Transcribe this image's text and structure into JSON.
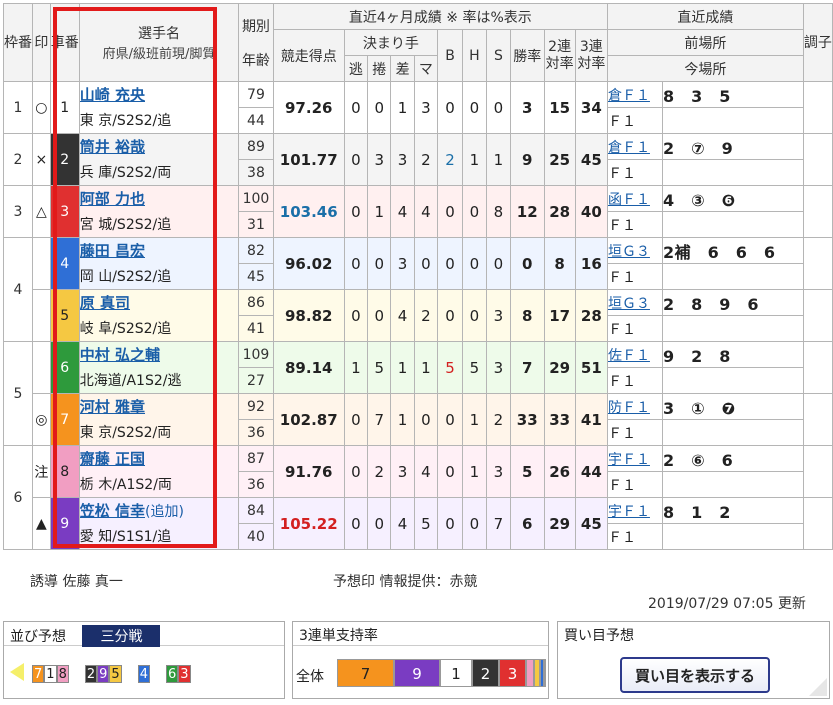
{
  "header": {
    "waku": "枠番",
    "shirushi": "印",
    "sha": "車番",
    "player_line1": "選手名",
    "player_line2": "府県/級班前現/脚質",
    "age_top": "期別",
    "age_bottom": "年齢",
    "recent4": "直近4ヶ月成績 ※ 率は%表示",
    "score": "競走得点",
    "kimarite": "決まり手",
    "k_nige": "逃",
    "k_makuri": "捲",
    "k_sashi": "差",
    "k_mark": "マ",
    "b": "B",
    "h": "H",
    "s": "S",
    "shoritsu": "勝率",
    "nirentai": "2連対率",
    "sanrentai": "3連対率",
    "recent": "直近成績",
    "zenba": "前場所",
    "konba": "今場所",
    "chosi": "調子"
  },
  "rows": [
    {
      "waku": "1",
      "mark": "○",
      "car": "1",
      "car_color": "#ffffff",
      "car_text": "#222222",
      "bg": "#ffffff",
      "name": "山崎 充央",
      "suffix": "",
      "pref": "東 京/S2S2/追",
      "ki": "79",
      "age": "44",
      "score": "97.26",
      "score_color": "",
      "nige": "0",
      "makuri": "0",
      "sashi": "1",
      "mark_k": "3",
      "b": "0",
      "b_color": "",
      "h": "0",
      "s": "0",
      "win": "3",
      "r2": "15",
      "r3": "34",
      "prev": "倉Ｆ１",
      "prev_res": "8　3　5",
      "cur": "Ｆ１",
      "cur_res": ""
    },
    {
      "waku": "2",
      "mark": "×",
      "car": "2",
      "car_color": "#333333",
      "car_text": "#ffffff",
      "bg": "#f4f4f4",
      "name": "筒井 裕哉",
      "suffix": "",
      "pref": "兵 庫/S2S2/両",
      "ki": "89",
      "age": "38",
      "score": "101.77",
      "score_color": "",
      "nige": "0",
      "makuri": "3",
      "sashi": "3",
      "mark_k": "2",
      "b": "2",
      "b_color": "blue",
      "h": "1",
      "s": "1",
      "win": "9",
      "r2": "25",
      "r3": "45",
      "prev": "倉Ｆ１",
      "prev_res": "2　⑦　9",
      "cur": "Ｆ１",
      "cur_res": ""
    },
    {
      "waku": "3",
      "mark": "△",
      "car": "3",
      "car_color": "#e03030",
      "car_text": "#ffffff",
      "bg": "#fff0f0",
      "name": "阿部 力也",
      "suffix": "",
      "pref": "宮 城/S2S2/追",
      "ki": "100",
      "age": "31",
      "score": "103.46",
      "score_color": "blue",
      "nige": "0",
      "makuri": "1",
      "sashi": "4",
      "mark_k": "4",
      "b": "0",
      "b_color": "",
      "h": "0",
      "s": "8",
      "win": "12",
      "r2": "28",
      "r3": "40",
      "prev": "函Ｆ１",
      "prev_res": "4　③　❻",
      "cur": "Ｆ１",
      "cur_res": ""
    },
    {
      "waku": "4",
      "mark": "",
      "car": "4",
      "car_color": "#2f6fd6",
      "car_text": "#ffffff",
      "bg": "#eef4ff",
      "name": "藤田 昌宏",
      "suffix": "",
      "pref": "岡 山/S2S2/追",
      "ki": "82",
      "age": "45",
      "score": "96.02",
      "score_color": "",
      "nige": "0",
      "makuri": "0",
      "sashi": "3",
      "mark_k": "0",
      "b": "0",
      "b_color": "",
      "h": "0",
      "s": "0",
      "win": "0",
      "r2": "8",
      "r3": "16",
      "prev": "垣Ｇ３",
      "prev_res": "2補　6　6　6",
      "cur": "Ｆ１",
      "cur_res": ""
    },
    {
      "waku": "",
      "mark": "",
      "car": "5",
      "car_color": "#f5c842",
      "car_text": "#222222",
      "bg": "#fffbe8",
      "name": "原 真司",
      "suffix": "",
      "pref": "岐 阜/S2S2/追",
      "ki": "86",
      "age": "41",
      "score": "98.82",
      "score_color": "",
      "nige": "0",
      "makuri": "0",
      "sashi": "4",
      "mark_k": "2",
      "b": "0",
      "b_color": "",
      "h": "0",
      "s": "3",
      "win": "8",
      "r2": "17",
      "r3": "28",
      "prev": "垣Ｇ３",
      "prev_res": "2　8　9　6",
      "cur": "Ｆ１",
      "cur_res": ""
    },
    {
      "waku": "5",
      "mark": "",
      "car": "6",
      "car_color": "#2e9a3c",
      "car_text": "#ffffff",
      "bg": "#eefbea",
      "name": "中村 弘之輔",
      "suffix": "",
      "pref": "北海道/A1S2/逃",
      "ki": "109",
      "age": "27",
      "score": "89.14",
      "score_color": "",
      "nige": "1",
      "makuri": "5",
      "sashi": "1",
      "mark_k": "1",
      "b": "5",
      "b_color": "red",
      "h": "5",
      "s": "3",
      "win": "7",
      "r2": "29",
      "r3": "51",
      "prev": "佐Ｆ１",
      "prev_res": "9　2　8",
      "cur": "Ｆ１",
      "cur_res": ""
    },
    {
      "waku": "",
      "mark": "◎",
      "car": "7",
      "car_color": "#f5931e",
      "car_text": "#ffffff",
      "bg": "#fff5ea",
      "name": "河村 雅章",
      "suffix": "",
      "pref": "東 京/S2S2/両",
      "ki": "92",
      "age": "36",
      "score": "102.87",
      "score_color": "",
      "nige": "0",
      "makuri": "7",
      "sashi": "1",
      "mark_k": "0",
      "b": "0",
      "b_color": "",
      "h": "1",
      "s": "2",
      "win": "33",
      "r2": "33",
      "r3": "41",
      "prev": "防Ｆ１",
      "prev_res": "3　①　❼",
      "cur": "Ｆ１",
      "cur_res": ""
    },
    {
      "waku": "6",
      "mark": "注",
      "car": "8",
      "car_color": "#f19ec2",
      "car_text": "#222222",
      "bg": "#fff0f6",
      "name": "齋藤 正国",
      "suffix": "",
      "pref": "栃 木/A1S2/両",
      "ki": "87",
      "age": "36",
      "score": "91.76",
      "score_color": "",
      "nige": "0",
      "makuri": "2",
      "sashi": "3",
      "mark_k": "4",
      "b": "0",
      "b_color": "",
      "h": "1",
      "s": "3",
      "win": "5",
      "r2": "26",
      "r3": "44",
      "prev": "宇Ｆ１",
      "prev_res": "2　⑥　6",
      "cur": "Ｆ１",
      "cur_res": ""
    },
    {
      "waku": "",
      "mark": "▲",
      "car": "9",
      "car_color": "#7a3cc2",
      "car_text": "#ffffff",
      "bg": "#f6f0ff",
      "name": "笠松 信幸",
      "suffix": "(追加)",
      "pref": "愛 知/S1S1/追",
      "ki": "84",
      "age": "40",
      "score": "105.22",
      "score_color": "red",
      "nige": "0",
      "makuri": "0",
      "sashi": "4",
      "mark_k": "5",
      "b": "0",
      "b_color": "",
      "h": "0",
      "s": "7",
      "win": "6",
      "r2": "29",
      "r3": "45",
      "prev": "宇Ｆ１",
      "prev_res": "8　1　2",
      "cur": "Ｆ１",
      "cur_res": ""
    }
  ],
  "footer": {
    "yudo": "誘導 佐藤 真一",
    "yoso": "予想印 情報提供：赤競",
    "updated": "2019/07/29 07:05 更新"
  },
  "narabi": {
    "title": "並び予想",
    "tag": "三分戦",
    "groups": [
      [
        {
          "n": "7",
          "c": "#f5931e",
          "t": "#ffffff"
        },
        {
          "n": "1",
          "c": "#ffffff",
          "t": "#222222"
        },
        {
          "n": "8",
          "c": "#f19ec2",
          "t": "#222222"
        }
      ],
      [
        {
          "n": "2",
          "c": "#333333",
          "t": "#ffffff"
        },
        {
          "n": "9",
          "c": "#7a3cc2",
          "t": "#ffffff"
        },
        {
          "n": "5",
          "c": "#f5c842",
          "t": "#222222"
        }
      ],
      [
        {
          "n": "4",
          "c": "#2f6fd6",
          "t": "#ffffff"
        }
      ],
      [
        {
          "n": "6",
          "c": "#2e9a3c",
          "t": "#ffffff"
        },
        {
          "n": "3",
          "c": "#e03030",
          "t": "#ffffff"
        }
      ]
    ]
  },
  "support": {
    "title": "3連単支持率",
    "label": "全体",
    "bars": [
      {
        "n": "7",
        "c": "#f5931e",
        "t": "#222222",
        "share": 0.27
      },
      {
        "n": "9",
        "c": "#7a3cc2",
        "t": "#ffffff",
        "share": 0.22
      },
      {
        "n": "1",
        "c": "#ffffff",
        "t": "#222222",
        "share": 0.15
      },
      {
        "n": "2",
        "c": "#333333",
        "t": "#ffffff",
        "share": 0.13
      },
      {
        "n": "3",
        "c": "#e03030",
        "t": "#ffffff",
        "share": 0.13
      },
      {
        "n": "",
        "c": "#f19ec2",
        "t": "#222222",
        "share": 0.04
      },
      {
        "n": "",
        "c": "#f5c842",
        "t": "#222222",
        "share": 0.03
      },
      {
        "n": "",
        "c": "#2f6fd6",
        "t": "#ffffff",
        "share": 0.02
      },
      {
        "n": "",
        "c": "#2e9a3c",
        "t": "#ffffff",
        "share": 0.01
      }
    ]
  },
  "kaime": {
    "title": "買い目予想",
    "button": "買い目を表示する"
  }
}
